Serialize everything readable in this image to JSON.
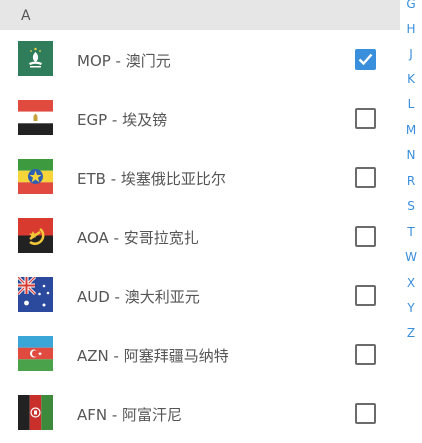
{
  "section_header": "A",
  "currencies": [
    {
      "label": "MOP - 澳门元",
      "flag": "macau-flag-icon",
      "checked": true
    },
    {
      "label": "EGP - 埃及镑",
      "flag": "egypt-flag-icon",
      "checked": false
    },
    {
      "label": "ETB - 埃塞俄比亚比尔",
      "flag": "ethiopia-flag-icon",
      "checked": false
    },
    {
      "label": "AOA - 安哥拉宽扎",
      "flag": "angola-flag-icon",
      "checked": false
    },
    {
      "label": "AUD - 澳大利亚元",
      "flag": "australia-flag-icon",
      "checked": false
    },
    {
      "label": "AZN - 阿塞拜疆马纳特",
      "flag": "azerbaijan-flag-icon",
      "checked": false
    },
    {
      "label": "AFN - 阿富汗尼",
      "flag": "afghanistan-flag-icon",
      "checked": false
    }
  ],
  "index_letters": [
    "G",
    "H",
    "J",
    "K",
    "L",
    "M",
    "N",
    "R",
    "S",
    "T",
    "W",
    "X",
    "Y",
    "Z"
  ],
  "colors": {
    "accent": "#3a8fdc",
    "header_bg": "#e6e6e6",
    "text": "#555555"
  }
}
